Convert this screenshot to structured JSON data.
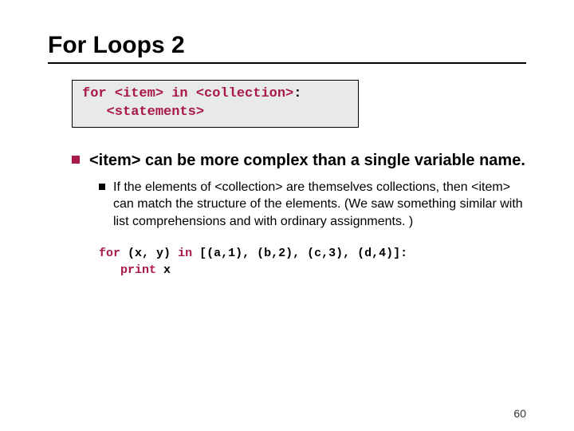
{
  "title": "For Loops 2",
  "syntax_box": {
    "for": "for",
    "item": "<item>",
    "in": "in",
    "collection": "<collection>",
    "colon": ":",
    "statements": "<statements>"
  },
  "main_bullet": {
    "lead_code": "<item>",
    "rest": " can be more complex than a single variable name."
  },
  "sub_bullet": {
    "p1": "If the elements of ",
    "c1": "<collection>",
    "p2": " are themselves collections, then ",
    "c2": "<item>",
    "p3": " can match the structure of the elements.  (We saw something similar with list comprehensions and with ordinary assignments. )"
  },
  "example": {
    "for": "for",
    "tuple": "(x, y)",
    "in": "in",
    "list": "[(a,1), (b,2), (c,3), (d,4)]:",
    "print_kw": "print",
    "print_arg": "x"
  },
  "page_number": "60"
}
